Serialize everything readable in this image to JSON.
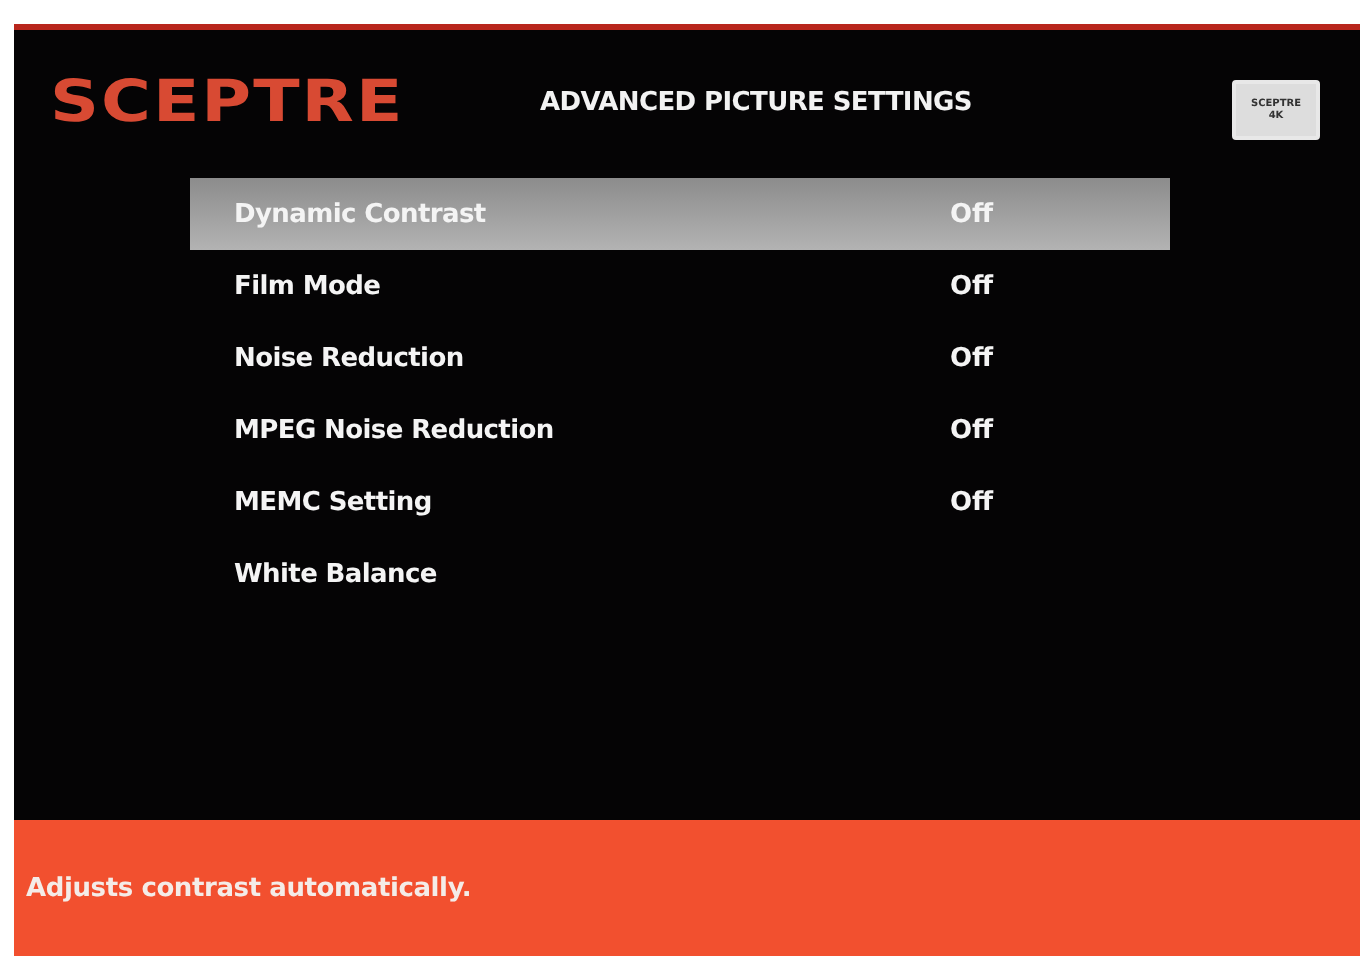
{
  "header": {
    "logo": "SCEPTRE",
    "title": "ADVANCED PICTURE SETTINGS",
    "tv_badge": {
      "brand": "SCEPTRE",
      "resolution": "4K"
    }
  },
  "settings": [
    {
      "label": "Dynamic Contrast",
      "value": "Off",
      "selected": true
    },
    {
      "label": "Film Mode",
      "value": "Off",
      "selected": false
    },
    {
      "label": "Noise Reduction",
      "value": "Off",
      "selected": false
    },
    {
      "label": "MPEG Noise Reduction",
      "value": "Off",
      "selected": false
    },
    {
      "label": "MEMC Setting",
      "value": "Off",
      "selected": false
    },
    {
      "label": "White Balance",
      "selected": false
    }
  ],
  "help_text": "Adjusts contrast automatically."
}
